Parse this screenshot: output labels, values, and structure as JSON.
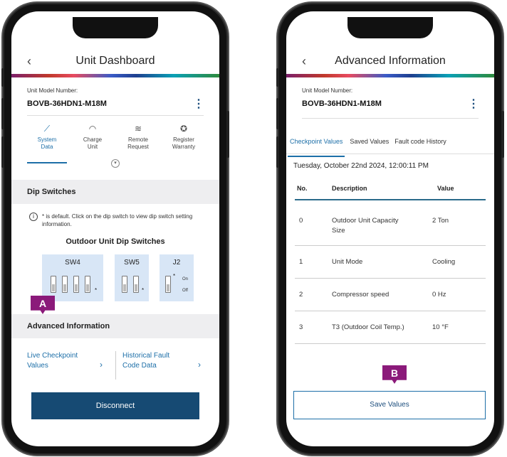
{
  "left_screen": {
    "header": {
      "back_icon": "chevron-left-icon",
      "back_glyph": "‹",
      "title": "Unit Dashboard"
    },
    "model": {
      "label": "Unit Model Number:",
      "value": "BOVB-36HDN1-M18M",
      "menu_glyph": "⋮"
    },
    "tabs": [
      {
        "icon": "chart-icon",
        "glyph": "⟋",
        "line1": "System",
        "line2": "Data",
        "active": true
      },
      {
        "icon": "gauge-icon",
        "glyph": "◠",
        "line1": "Charge",
        "line2": "Unit",
        "active": false
      },
      {
        "icon": "wifi-icon",
        "glyph": "≋",
        "line1": "Remote",
        "line2": "Request",
        "active": false
      },
      {
        "icon": "award-icon",
        "glyph": "✪",
        "line1": "Register",
        "line2": "Warranty",
        "active": false
      }
    ],
    "dip_section": {
      "title": "Dip Switches",
      "info_glyph": "i",
      "info_text": "* is default. Click on the dip switch to view dip switch setting information.",
      "subtitle": "Outdoor Unit Dip Switches",
      "sw4_label": "SW4",
      "sw5_label": "SW5",
      "j2_label": "J2",
      "on_label": "On",
      "off_label": "Off",
      "default_mark": "*"
    },
    "badge_a": "A",
    "advanced": {
      "title": "Advanced Information",
      "live_line1": "Live Checkpoint",
      "live_line2": "Values",
      "hist_line1": "Historical Fault",
      "hist_line2": "Code Data",
      "chevron_glyph": "›"
    },
    "disconnect_label": "Disconnect"
  },
  "right_screen": {
    "header": {
      "back_glyph": "‹",
      "title": "Advanced Information"
    },
    "model": {
      "label": "Unit Model Number:",
      "value": "BOVB-36HDN1-M18M",
      "menu_glyph": "⋮"
    },
    "tabs": [
      "Checkpoint Values",
      "Saved Values",
      "Fault code History"
    ],
    "timestamp": "Tuesday, October 22nd 2024, 12:00:11 PM",
    "table": {
      "headers": [
        "No.",
        "Description",
        "Value"
      ],
      "rows": [
        {
          "no": "0",
          "line1": "Outdoor Unit Capacity",
          "line2": "Size",
          "value": "2 Ton"
        },
        {
          "no": "1",
          "line1": "Unit Mode",
          "line2": "",
          "value": "Cooling"
        },
        {
          "no": "2",
          "line1": "Compressor speed",
          "line2": "",
          "value": "0 Hz"
        },
        {
          "no": "3",
          "line1": "T3 (Outdoor Coil Temp.)",
          "line2": "",
          "value": "10 °F"
        }
      ]
    },
    "badge_b": "B",
    "save_label": "Save Values"
  },
  "colors": {
    "accent": "#1d6fa8",
    "primary_button": "#164a73",
    "badge": "#8b1a7a",
    "dip_bg": "#d8e6f6"
  }
}
